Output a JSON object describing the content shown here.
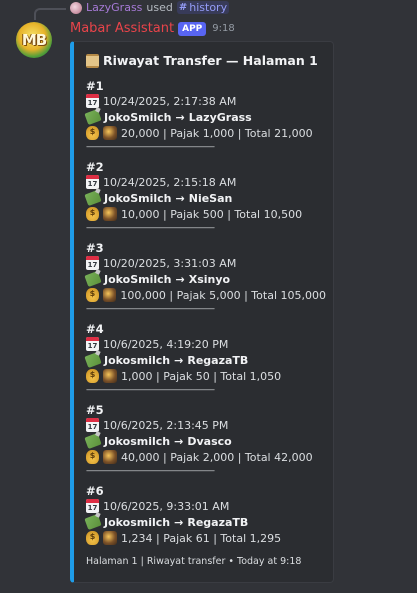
{
  "reply": {
    "user": "LazyGrass",
    "used_text": "used",
    "command": "history"
  },
  "message": {
    "bot_name": "Mabar Assistant",
    "app_badge": "APP",
    "timestamp": "9:18",
    "avatar_text": "MB"
  },
  "embed": {
    "accent_color": "#1e9ce8",
    "title": "Riwayat Transfer — Halaman 1",
    "footer": "Halaman 1 | Riwayat transfer • Today at 9:18",
    "separator": "————————————————",
    "entries": [
      {
        "number": "#1",
        "datetime": "10/24/2025, 2:17:38 AM",
        "from": "JokoSmilch",
        "to": "LazyGrass",
        "amount_line": "20,000 | Pajak 1,000 | Total 21,000"
      },
      {
        "number": "#2",
        "datetime": "10/24/2025, 2:15:18 AM",
        "from": "JokoSmilch",
        "to": "NieSan",
        "amount_line": "10,000 | Pajak 500 | Total 10,500"
      },
      {
        "number": "#3",
        "datetime": "10/20/2025, 3:31:03 AM",
        "from": "JokoSmilch",
        "to": "Xsinyo",
        "amount_line": "100,000 | Pajak 5,000 | Total 105,000"
      },
      {
        "number": "#4",
        "datetime": "10/6/2025, 4:19:20 PM",
        "from": "Jokosmilch",
        "to": "RegazaTB",
        "amount_line": "1,000 | Pajak 50 | Total 1,050"
      },
      {
        "number": "#5",
        "datetime": "10/6/2025, 2:13:45 PM",
        "from": "Jokosmilch",
        "to": "Dvasco",
        "amount_line": "40,000 | Pajak 2,000 | Total 42,000"
      },
      {
        "number": "#6",
        "datetime": "10/6/2025, 9:33:01 AM",
        "from": "Jokosmilch",
        "to": "RegazaTB",
        "amount_line": "1,234 | Pajak 61 | Total 1,295"
      }
    ]
  },
  "icons": {
    "title": "scroll-icon",
    "date": "calendar-icon",
    "transfer": "money-with-wings-icon",
    "amount": "money-bag-icon",
    "tax": "coin-icon"
  }
}
